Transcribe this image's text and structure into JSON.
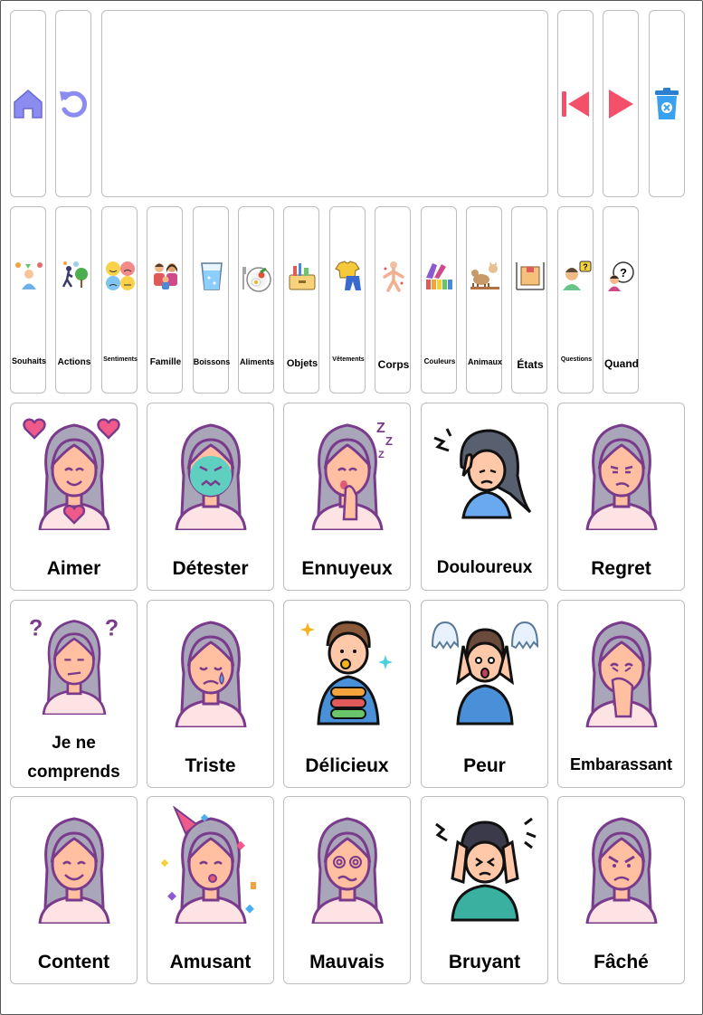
{
  "toolbar": {
    "home": "home-icon",
    "undo": "undo-icon",
    "first": "skip-back-icon",
    "play": "play-icon",
    "clear": "trash-icon",
    "message_text": ""
  },
  "categories": [
    {
      "label": "Souhaits"
    },
    {
      "label": "Actions"
    },
    {
      "label": "Sentiments"
    },
    {
      "label": "Famille"
    },
    {
      "label": "Boissons"
    },
    {
      "label": "Aliments"
    },
    {
      "label": "Objets"
    },
    {
      "label": "Vêtements"
    },
    {
      "label": "Corps"
    },
    {
      "label": "Couleurs"
    },
    {
      "label": "Animaux"
    },
    {
      "label": "États"
    },
    {
      "label": "Questions"
    },
    {
      "label": "Quand"
    }
  ],
  "cards": [
    {
      "label": "Aimer"
    },
    {
      "label": "Détester"
    },
    {
      "label": "Ennuyeux"
    },
    {
      "label": "Douloureux"
    },
    {
      "label": "Regret"
    },
    {
      "label": "Je ne"
    },
    {
      "label": "comprends pas"
    },
    {
      "label": "Triste"
    },
    {
      "label": "Délicieux"
    },
    {
      "label": "Peur"
    },
    {
      "label": "Embarassant"
    },
    {
      "label": "Content"
    },
    {
      "label": "Amusant"
    },
    {
      "label": "Mauvais"
    },
    {
      "label": "Bruyant"
    },
    {
      "label": "Fâché"
    }
  ],
  "colors": {
    "toolbar_icon": "#8c8cf0",
    "play_red": "#f4506a",
    "trash_blue": "#3aa0f0",
    "hair": "#a8a6b8",
    "outline": "#7a3b8c",
    "skin": "#ffbfa0",
    "shirt": "#fde3e3"
  }
}
